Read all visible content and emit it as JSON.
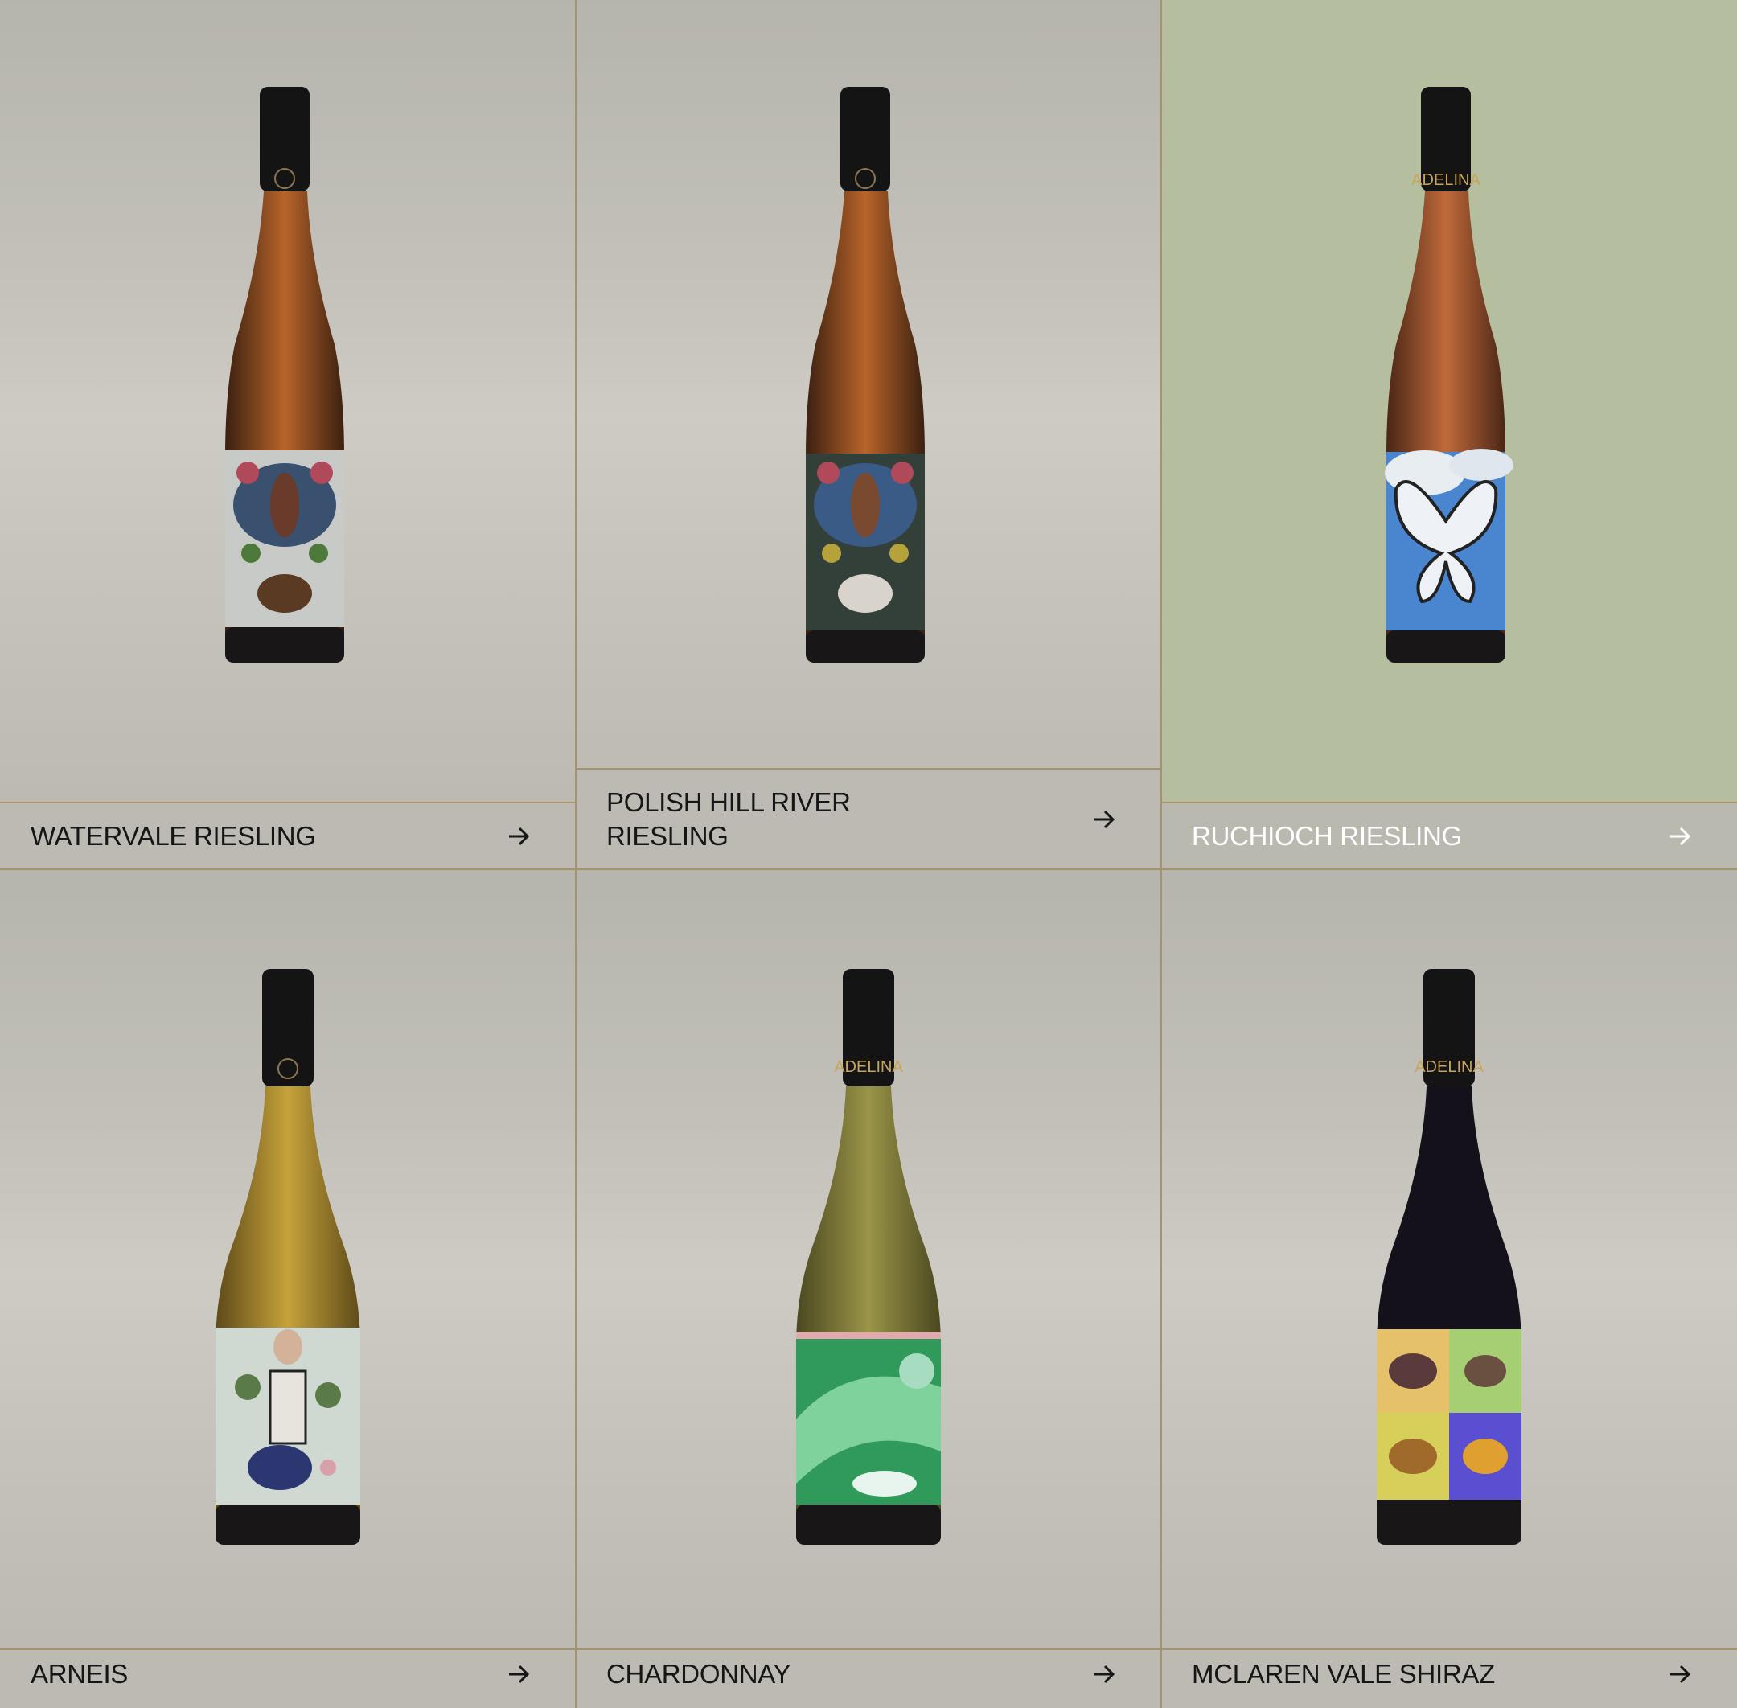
{
  "products": [
    {
      "name": "WATERVALE RIESLING",
      "label_style": "butterfly-floral-light",
      "wine": "#b8642a",
      "capsule_text": "",
      "caption_color": "dark"
    },
    {
      "name": "POLISH HILL RIVER RIESLING",
      "label_style": "butterfly-floral-dark",
      "wine": "#b8642a",
      "capsule_text": "",
      "caption_color": "dark"
    },
    {
      "name": "RUCHIOCH RIESLING",
      "label_style": "butterfly-sky",
      "wine": "#c06a3a",
      "capsule_text": "ADELINA",
      "caption_color": "light"
    },
    {
      "name": "ARNEIS",
      "label_style": "skeleton-collage",
      "wine": "#b79a3c",
      "capsule_text": "",
      "caption_color": "dark"
    },
    {
      "name": "CHARDONNAY",
      "label_style": "green-swirl",
      "wine": "#8f8a48",
      "capsule_text": "ADELINA",
      "caption_color": "dark"
    },
    {
      "name": "MCLAREN VALE SHIRAZ",
      "label_style": "butterfly-pop-grid",
      "wine": "#1a1416",
      "capsule_text": "ADELINA",
      "caption_color": "dark"
    }
  ],
  "icons": {
    "arrow": "arrow-right-icon"
  },
  "colors": {
    "border": "#a8926b",
    "highlight_bg": "#b5bf9f",
    "text_dark": "#161616",
    "text_light": "#ffffff"
  }
}
